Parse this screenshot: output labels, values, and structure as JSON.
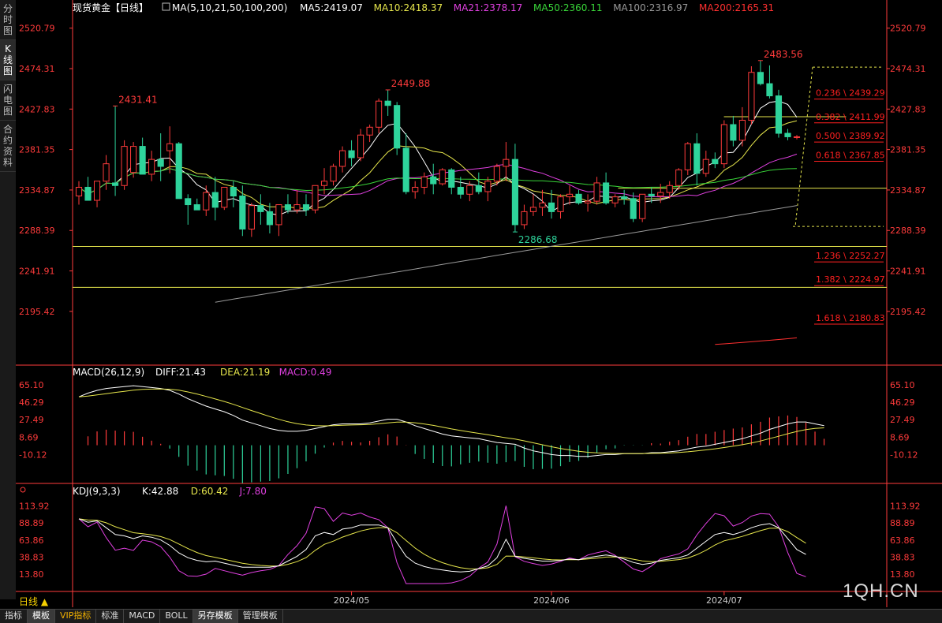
{
  "side_tabs": [
    "分时图",
    "K线图",
    "闪电图",
    "合约资料"
  ],
  "side_active": 1,
  "period_label": "日线 ▲",
  "bottom_tabs": [
    {
      "label": "指标",
      "active": false,
      "vip": false
    },
    {
      "label": "模板",
      "active": true,
      "vip": false
    },
    {
      "label": "VIP指标",
      "active": false,
      "vip": true
    },
    {
      "label": "标准",
      "active": false,
      "vip": false
    },
    {
      "label": "MACD",
      "active": false,
      "vip": false
    },
    {
      "label": "BOLL",
      "active": false,
      "vip": false
    },
    {
      "label": "另存模板",
      "active": true,
      "vip": false
    },
    {
      "label": "管理模板",
      "active": false,
      "vip": false
    }
  ],
  "watermark": "1QH.CN",
  "header": {
    "title": "现货黄金【日线】",
    "ma_label": "MA(5,10,21,50,100,200)",
    "items": [
      {
        "text": "MA5:2419.07",
        "color": "#ffffff"
      },
      {
        "text": "MA10:2418.37",
        "color": "#e6e64c"
      },
      {
        "text": "MA21:2378.17",
        "color": "#e040e0"
      },
      {
        "text": "MA50:2360.11",
        "color": "#39d639"
      },
      {
        "text": "MA100:2316.97",
        "color": "#9a9a9a"
      },
      {
        "text": "MA200:2165.31",
        "color": "#ff3030"
      }
    ]
  },
  "colors": {
    "up": "#ff3b3b",
    "down": "#2ed39b",
    "axis": "#ff3b3b",
    "fib": "#ff2020"
  },
  "chart_data": [
    {
      "type": "candlestick",
      "title": "现货黄金【日线】",
      "ylim": [
        2150,
        2535
      ],
      "y_ticks": [
        2520.79,
        2474.31,
        2427.83,
        2381.35,
        2334.87,
        2288.39,
        2241.91,
        2195.42
      ],
      "x_ticks": [
        {
          "label": "2024/05",
          "index": 30
        },
        {
          "label": "2024/06",
          "index": 52
        },
        {
          "label": "2024/07",
          "index": 71
        }
      ],
      "ohlc": [
        [
          2328,
          2345,
          2318,
          2338
        ],
        [
          2338,
          2350,
          2330,
          2323
        ],
        [
          2323,
          2345,
          2315,
          2345
        ],
        [
          2345,
          2375,
          2335,
          2365
        ],
        [
          2343,
          2431.41,
          2328,
          2340
        ],
        [
          2340,
          2392,
          2335,
          2385
        ],
        [
          2355,
          2390,
          2349,
          2385
        ],
        [
          2385,
          2395,
          2355,
          2353
        ],
        [
          2353,
          2380,
          2345,
          2370
        ],
        [
          2370,
          2400,
          2345,
          2362
        ],
        [
          2380,
          2408,
          2354,
          2388
        ],
        [
          2388,
          2390,
          2325,
          2325
        ],
        [
          2325,
          2330,
          2295,
          2318
        ],
        [
          2318,
          2325,
          2315,
          2312
        ],
        [
          2312,
          2340,
          2305,
          2332
        ],
        [
          2332,
          2350,
          2300,
          2315
        ],
        [
          2315,
          2338,
          2312,
          2338
        ],
        [
          2338,
          2345,
          2315,
          2328
        ],
        [
          2328,
          2340,
          2282,
          2290
        ],
        [
          2290,
          2320,
          2281,
          2317
        ],
        [
          2317,
          2330,
          2295,
          2310
        ],
        [
          2310,
          2320,
          2285,
          2295
        ],
        [
          2295,
          2318,
          2282,
          2318
        ],
        [
          2318,
          2330,
          2308,
          2312
        ],
        [
          2312,
          2335,
          2308,
          2318
        ],
        [
          2318,
          2330,
          2305,
          2312
        ],
        [
          2312,
          2340,
          2308,
          2340
        ],
        [
          2340,
          2360,
          2330,
          2345
        ],
        [
          2345,
          2365,
          2340,
          2362
        ],
        [
          2362,
          2385,
          2355,
          2380
        ],
        [
          2380,
          2392,
          2362,
          2372
        ],
        [
          2372,
          2405,
          2368,
          2398
        ],
        [
          2398,
          2410,
          2390,
          2407
        ],
        [
          2407,
          2440,
          2400,
          2437
        ],
        [
          2437,
          2449.88,
          2420,
          2432
        ],
        [
          2432,
          2436,
          2375,
          2383
        ],
        [
          2383,
          2400,
          2330,
          2333
        ],
        [
          2333,
          2345,
          2325,
          2338
        ],
        [
          2338,
          2355,
          2330,
          2350
        ],
        [
          2350,
          2365,
          2330,
          2342
        ],
        [
          2342,
          2360,
          2340,
          2358
        ],
        [
          2358,
          2360,
          2330,
          2338
        ],
        [
          2338,
          2350,
          2325,
          2330
        ],
        [
          2330,
          2345,
          2322,
          2340
        ],
        [
          2340,
          2355,
          2330,
          2333
        ],
        [
          2333,
          2350,
          2322,
          2345
        ],
        [
          2345,
          2365,
          2340,
          2362
        ],
        [
          2362,
          2390,
          2345,
          2370
        ],
        [
          2370,
          2388,
          2286.68,
          2295
        ],
        [
          2295,
          2318,
          2290,
          2310
        ],
        [
          2310,
          2330,
          2305,
          2315
        ],
        [
          2315,
          2335,
          2305,
          2320
        ],
        [
          2320,
          2335,
          2302,
          2310
        ],
        [
          2310,
          2330,
          2302,
          2327
        ],
        [
          2327,
          2340,
          2318,
          2330
        ],
        [
          2330,
          2335,
          2318,
          2320
        ],
        [
          2320,
          2330,
          2310,
          2322
        ],
        [
          2322,
          2350,
          2318,
          2343
        ],
        [
          2343,
          2355,
          2318,
          2320
        ],
        [
          2320,
          2330,
          2315,
          2327
        ],
        [
          2327,
          2335,
          2318,
          2325
        ],
        [
          2325,
          2332,
          2298,
          2302
        ],
        [
          2302,
          2330,
          2298,
          2330
        ],
        [
          2330,
          2338,
          2320,
          2328
        ],
        [
          2328,
          2342,
          2320,
          2332
        ],
        [
          2332,
          2345,
          2325,
          2340
        ],
        [
          2340,
          2360,
          2335,
          2358
        ],
        [
          2358,
          2390,
          2352,
          2388
        ],
        [
          2388,
          2400,
          2340,
          2354
        ],
        [
          2354,
          2380,
          2350,
          2370
        ],
        [
          2370,
          2378,
          2360,
          2365
        ],
        [
          2365,
          2415,
          2360,
          2410
        ],
        [
          2410,
          2420,
          2385,
          2392
        ],
        [
          2392,
          2430,
          2385,
          2415
        ],
        [
          2415,
          2477,
          2410,
          2470
        ],
        [
          2470,
          2483.56,
          2455,
          2457
        ],
        [
          2457,
          2478,
          2440,
          2443
        ],
        [
          2443,
          2450,
          2395,
          2400
        ],
        [
          2400,
          2405,
          2392,
          2396
        ],
        [
          2396,
          2398,
          2393,
          2396
        ]
      ],
      "moving_averages": [
        {
          "name": "MA5",
          "color": "#ffffff"
        },
        {
          "name": "MA10",
          "color": "#e6e64c"
        },
        {
          "name": "MA21",
          "color": "#e040e0"
        },
        {
          "name": "MA50",
          "color": "#39d639"
        },
        {
          "name": "MA100",
          "color": "#9a9a9a"
        },
        {
          "name": "MA200",
          "color": "#ff3030"
        }
      ],
      "annotations": [
        {
          "text": "2431.41",
          "index": 4,
          "price": 2431.41,
          "pos": "top"
        },
        {
          "text": "2449.88",
          "index": 34,
          "price": 2449.88,
          "pos": "top"
        },
        {
          "text": "2286.68",
          "index": 48,
          "price": 2286.68,
          "pos": "bottom"
        },
        {
          "text": "2483.56",
          "index": 75,
          "price": 2483.56,
          "pos": "top"
        }
      ],
      "fib_labels": [
        {
          "text": "0.236 \\ 2439.29",
          "price": 2439.29
        },
        {
          "text": "0.382 \\ 2411.99",
          "price": 2411.99
        },
        {
          "text": "0.500 \\ 2389.92",
          "price": 2389.92
        },
        {
          "text": "0.618 \\ 2367.85",
          "price": 2367.85
        },
        {
          "text": "1.236 \\ 2252.27",
          "price": 2252.27
        },
        {
          "text": "1.382 \\ 2224.97",
          "price": 2224.97
        },
        {
          "text": "1.618 \\ 2180.83",
          "price": 2180.83
        }
      ],
      "horizontal_lines": [
        {
          "price": 2270,
          "from": 0,
          "to": 1
        },
        {
          "price": 2223,
          "from": 0,
          "to": 1
        },
        {
          "price": 2337,
          "from": 0.67,
          "to": 1
        },
        {
          "price": 2419,
          "from": 0.8,
          "to": 0.95
        }
      ]
    },
    {
      "type": "line",
      "title": "MACD(26,12,9)",
      "items": [
        {
          "text": "DIFF:21.43",
          "color": "#ffffff"
        },
        {
          "text": "DEA:21.19",
          "color": "#e6e64c"
        },
        {
          "text": "MACD:0.49",
          "color": "#e040e0"
        }
      ],
      "ylim": [
        -30,
        70
      ],
      "y_ticks": [
        65.1,
        46.29,
        27.49,
        8.69,
        -10.12
      ],
      "diff": [
        52,
        56,
        59,
        61,
        62,
        63,
        64,
        63,
        62,
        61,
        59,
        55,
        50,
        46,
        42,
        39,
        36,
        32,
        27,
        24,
        21,
        18,
        16,
        15,
        15,
        16,
        18,
        20,
        22,
        23,
        23,
        23,
        24,
        26,
        28,
        28,
        25,
        21,
        18,
        15,
        12,
        10,
        9,
        8,
        7,
        5,
        3,
        2,
        1,
        -3,
        -6,
        -8,
        -10,
        -11,
        -11,
        -12,
        -12,
        -11,
        -10,
        -10,
        -9,
        -9,
        -9,
        -8,
        -8,
        -7,
        -6,
        -4,
        -2,
        -1,
        1,
        3,
        5,
        7,
        10,
        13,
        17,
        20,
        23,
        25,
        25,
        23,
        21
      ]
    },
    {
      "type": "line",
      "title": "KDJ(9,3,3)",
      "items": [
        {
          "text": "K:42.88",
          "color": "#ffffff"
        },
        {
          "text": "D:60.42",
          "color": "#e6e64c"
        },
        {
          "text": "J:7.80",
          "color": "#e040e0"
        }
      ],
      "ylim": [
        0,
        125
      ],
      "y_ticks": [
        113.92,
        88.89,
        63.86,
        38.83,
        13.8
      ],
      "k": [
        95,
        90,
        92,
        82,
        72,
        70,
        66,
        70,
        68,
        64,
        56,
        45,
        38,
        34,
        32,
        33,
        30,
        27,
        24,
        24,
        24,
        24,
        26,
        33,
        40,
        50,
        70,
        75,
        72,
        80,
        82,
        86,
        86,
        86,
        82,
        60,
        40,
        30,
        25,
        22,
        20,
        18,
        17,
        18,
        22,
        26,
        38,
        65,
        40,
        37,
        35,
        33,
        33,
        34,
        36,
        35,
        38,
        40,
        42,
        40,
        36,
        31,
        28,
        30,
        34,
        36,
        38,
        42,
        52,
        62,
        72,
        75,
        72,
        76,
        82,
        86,
        88,
        82,
        66,
        50,
        42.88
      ]
    }
  ]
}
